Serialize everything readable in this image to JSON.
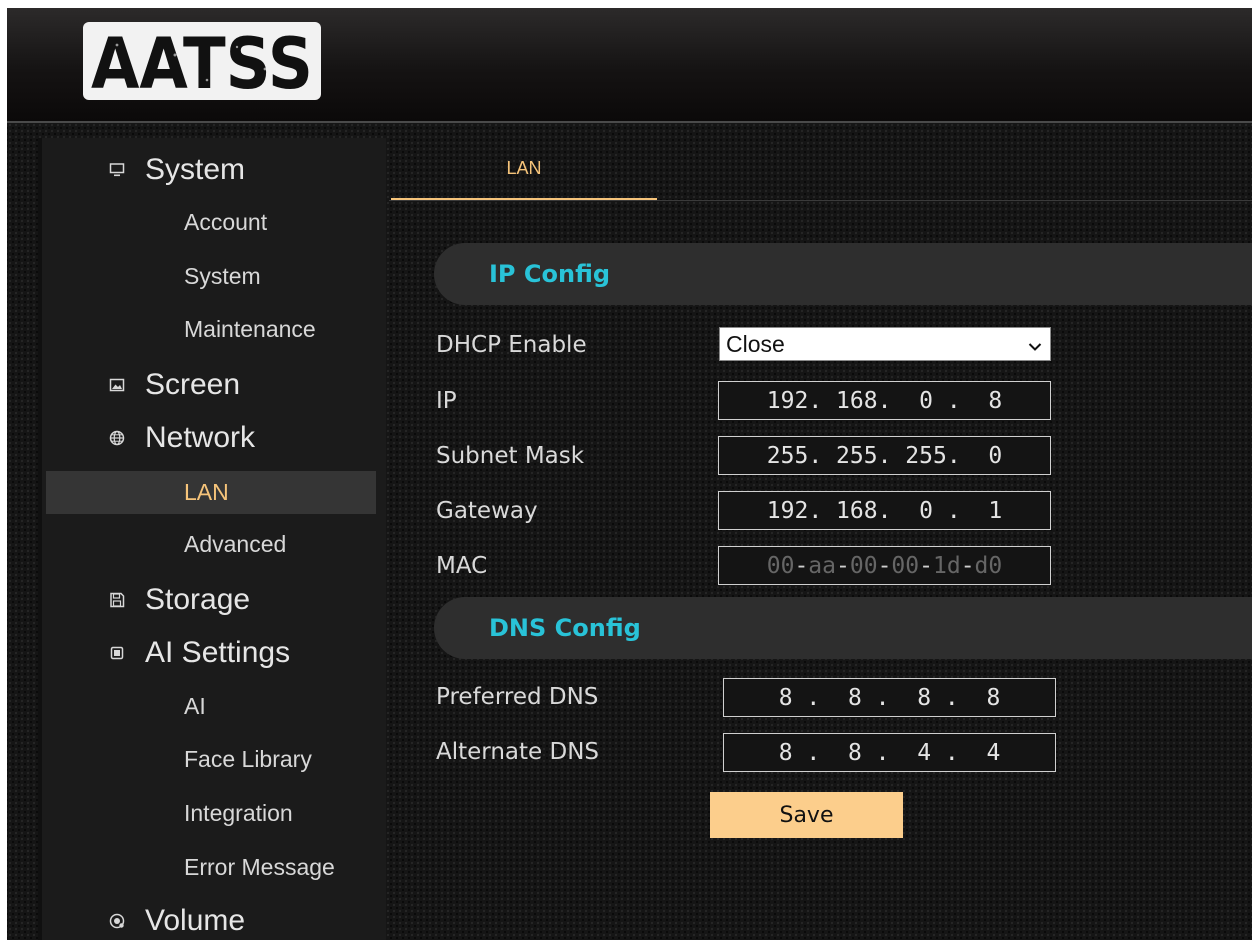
{
  "brand": {
    "logo_text": "AATSS"
  },
  "sidebar": {
    "sections": [
      {
        "label": "System",
        "icon": "monitor-icon",
        "items": [
          "Account",
          "System",
          "Maintenance"
        ]
      },
      {
        "label": "Screen",
        "icon": "image-icon",
        "items": []
      },
      {
        "label": "Network",
        "icon": "globe-icon",
        "items": [
          "LAN",
          "Advanced"
        ],
        "active_item": "LAN"
      },
      {
        "label": "Storage",
        "icon": "floppy-icon",
        "items": []
      },
      {
        "label": "AI Settings",
        "icon": "chip-icon",
        "items": [
          "AI",
          "Face Library",
          "Integration",
          "Error Message"
        ]
      },
      {
        "label": "Volume",
        "icon": "speaker-icon",
        "items": []
      }
    ]
  },
  "tabs": [
    {
      "label": "LAN",
      "active": true
    }
  ],
  "ip_config": {
    "title": "IP Config",
    "dhcp": {
      "label": "DHCP Enable",
      "value": "Close"
    },
    "ip": {
      "label": "IP",
      "octets": [
        "192",
        "168",
        "0",
        "8"
      ]
    },
    "subnet": {
      "label": "Subnet Mask",
      "octets": [
        "255",
        "255",
        "255",
        "0"
      ]
    },
    "gateway": {
      "label": "Gateway",
      "octets": [
        "192",
        "168",
        "0",
        "1"
      ]
    },
    "mac": {
      "label": "MAC",
      "parts": [
        "00",
        "aa",
        "00",
        "00",
        "1d",
        "d0"
      ]
    }
  },
  "dns_config": {
    "title": "DNS Config",
    "preferred": {
      "label": "Preferred DNS",
      "octets": [
        "8",
        "8",
        "8",
        "8"
      ]
    },
    "alternate": {
      "label": "Alternate DNS",
      "octets": [
        "8",
        "8",
        "4",
        "4"
      ]
    }
  },
  "save_label": "Save",
  "colors": {
    "accent": "#f6c47a",
    "section_title": "#29c3d8",
    "save_bg": "#fcce8c"
  }
}
